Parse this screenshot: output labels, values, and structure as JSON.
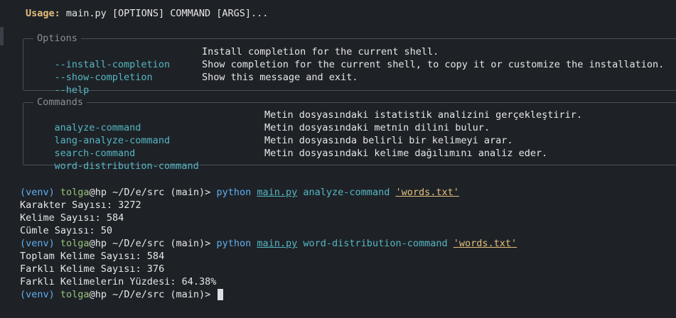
{
  "usage": {
    "label": "Usage:",
    "text": " main.py [OPTIONS] COMMAND [ARGS]..."
  },
  "options_panel": {
    "title": "Options",
    "items": [
      {
        "flag": "--install-completion",
        "desc": "Install completion for the current shell."
      },
      {
        "flag": "--show-completion",
        "desc": "Show completion for the current shell, to copy it or customize the installation."
      },
      {
        "flag": "--help",
        "desc": "Show this message and exit."
      }
    ]
  },
  "commands_panel": {
    "title": "Commands",
    "items": [
      {
        "name": "analyze-command",
        "desc": "Metin dosyasındaki istatistik analizini gerçekleştirir."
      },
      {
        "name": "lang-analyze-command",
        "desc": "Metin dosyasındaki metnin dilini bulur."
      },
      {
        "name": "search-command",
        "desc": "Metin dosyasında belirli bir kelimeyi arar."
      },
      {
        "name": "word-distribution-command",
        "desc": "Metin dosyasındaki kelime dağılımını analiz eder."
      }
    ]
  },
  "prompt": {
    "venv": "(venv)",
    "user": "tolga",
    "host": "@hp",
    "path": "~/D/e/src",
    "branch": "(main)>",
    "python": "python",
    "script": "main.py"
  },
  "session": [
    {
      "command": "analyze-command",
      "arg": "'words.txt'",
      "output": [
        "Karakter Sayısı: 3272",
        "Kelime Sayısı: 584",
        "Cümle Sayısı: 50"
      ]
    },
    {
      "command": "word-distribution-command",
      "arg": "'words.txt'",
      "output": [
        "Toplam Kelime Sayısı: 584",
        "Farklı Kelime Sayısı: 376",
        "Farklı Kelimelerin Yüzdesi: 64.38%"
      ]
    }
  ]
}
